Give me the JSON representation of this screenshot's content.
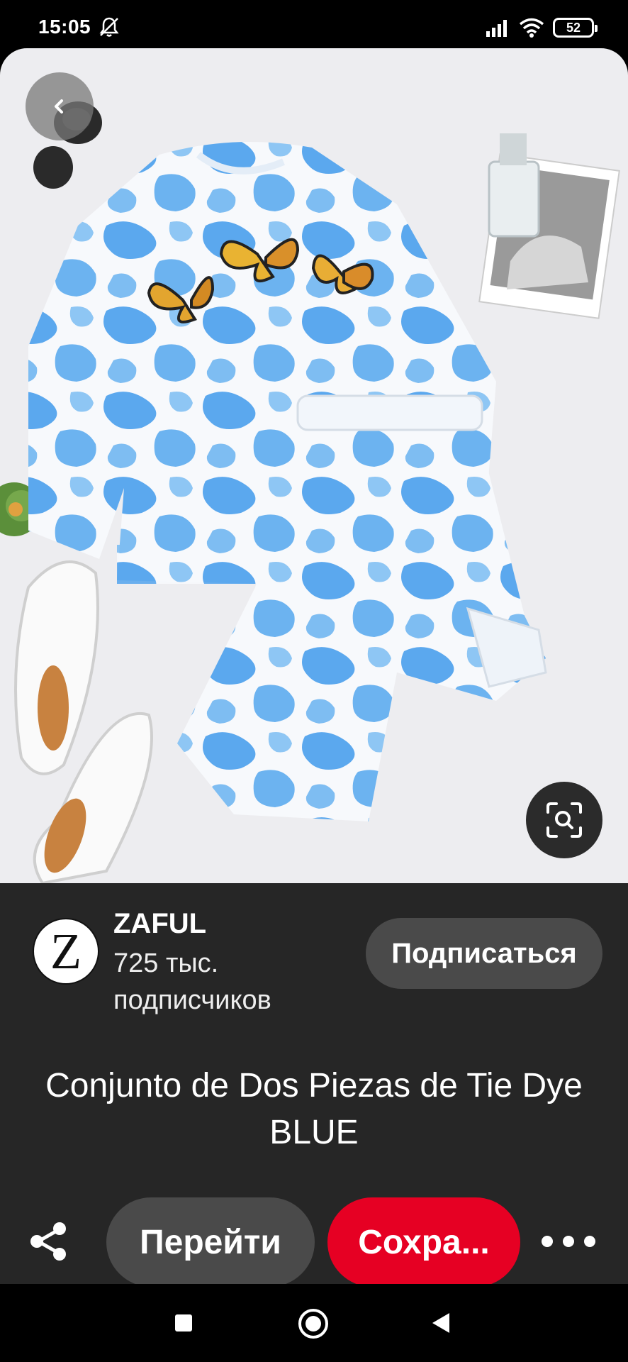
{
  "status_bar": {
    "time": "15:05",
    "battery": "52",
    "icons": [
      "mute-icon",
      "signal-icon",
      "wifi-icon",
      "battery-icon"
    ]
  },
  "pin": {
    "image_alt": "Tie dye two-piece set",
    "title": "Conjunto de Dos Piezas de Tie Dye   BLUE"
  },
  "creator": {
    "avatar_letter": "Z",
    "name": "ZAFUL",
    "followers": "725 тыс. подписчиков",
    "follow_label": "Подписаться"
  },
  "actions": {
    "go_label": "Перейти",
    "save_label": "Сохра...",
    "save_color": "#e60023"
  },
  "colors": {
    "card_bg": "#262626",
    "button_bg": "#4a4a4a",
    "tie_dye_blue": "#5ba8ee"
  }
}
